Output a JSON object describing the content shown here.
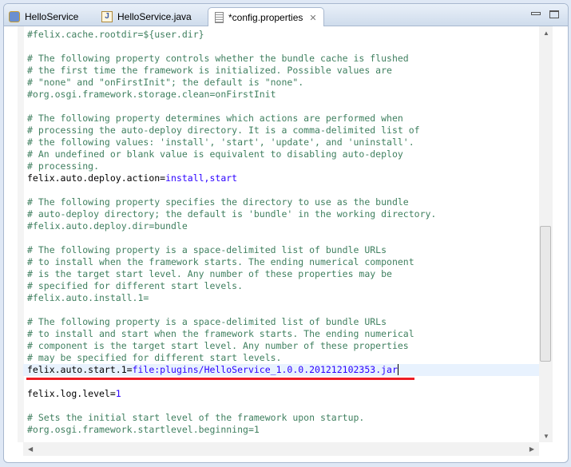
{
  "tabs": [
    {
      "label": "HelloService",
      "icon": "plugin-icon"
    },
    {
      "label": "HelloService.java",
      "icon": "java-file-icon"
    },
    {
      "label": "*config.properties",
      "icon": "text-file-icon",
      "active": true
    }
  ],
  "lines": [
    {
      "t": "c",
      "text": "#felix.cache.rootdir=${user.dir}"
    },
    {
      "t": "c",
      "text": ""
    },
    {
      "t": "c",
      "text": "# The following property controls whether the bundle cache is flushed"
    },
    {
      "t": "c",
      "text": "# the first time the framework is initialized. Possible values are"
    },
    {
      "t": "c",
      "text": "# \"none\" and \"onFirstInit\"; the default is \"none\"."
    },
    {
      "t": "c",
      "text": "#org.osgi.framework.storage.clean=onFirstInit"
    },
    {
      "t": "c",
      "text": ""
    },
    {
      "t": "c",
      "text": "# The following property determines which actions are performed when"
    },
    {
      "t": "c",
      "text": "# processing the auto-deploy directory. It is a comma-delimited list of"
    },
    {
      "t": "c",
      "text": "# the following values: 'install', 'start', 'update', and 'uninstall'."
    },
    {
      "t": "c",
      "text": "# An undefined or blank value is equivalent to disabling auto-deploy"
    },
    {
      "t": "c",
      "text": "# processing."
    },
    {
      "t": "kv",
      "key": "felix.auto.deploy.action=",
      "value": "install,start"
    },
    {
      "t": "c",
      "text": ""
    },
    {
      "t": "c",
      "text": "# The following property specifies the directory to use as the bundle"
    },
    {
      "t": "c",
      "text": "# auto-deploy directory; the default is 'bundle' in the working directory."
    },
    {
      "t": "c",
      "text": "#felix.auto.deploy.dir=bundle"
    },
    {
      "t": "c",
      "text": ""
    },
    {
      "t": "c",
      "text": "# The following property is a space-delimited list of bundle URLs"
    },
    {
      "t": "c",
      "text": "# to install when the framework starts. The ending numerical component"
    },
    {
      "t": "c",
      "text": "# is the target start level. Any number of these properties may be"
    },
    {
      "t": "c",
      "text": "# specified for different start levels."
    },
    {
      "t": "c",
      "text": "#felix.auto.install.1="
    },
    {
      "t": "c",
      "text": ""
    },
    {
      "t": "c",
      "text": "# The following property is a space-delimited list of bundle URLs"
    },
    {
      "t": "c",
      "text": "# to install and start when the framework starts. The ending numerical"
    },
    {
      "t": "c",
      "text": "# component is the target start level. Any number of these properties"
    },
    {
      "t": "c",
      "text": "# may be specified for different start levels."
    },
    {
      "t": "kv",
      "key": "felix.auto.start.1=",
      "value": "file:plugins/HelloService_1.0.0.201212102353.jar",
      "current": true
    },
    {
      "t": "c",
      "text": ""
    },
    {
      "t": "kv",
      "key": "felix.log.level=",
      "value": "1"
    },
    {
      "t": "c",
      "text": ""
    },
    {
      "t": "c",
      "text": "# Sets the initial start level of the framework upon startup."
    },
    {
      "t": "c",
      "text": "#org.osgi.framework.startlevel.beginning=1"
    }
  ],
  "colors": {
    "comment": "#3f7f5f",
    "value": "#2a00ff",
    "highlight_underline": "#ee1c25",
    "current_line": "#e8f2fe"
  }
}
